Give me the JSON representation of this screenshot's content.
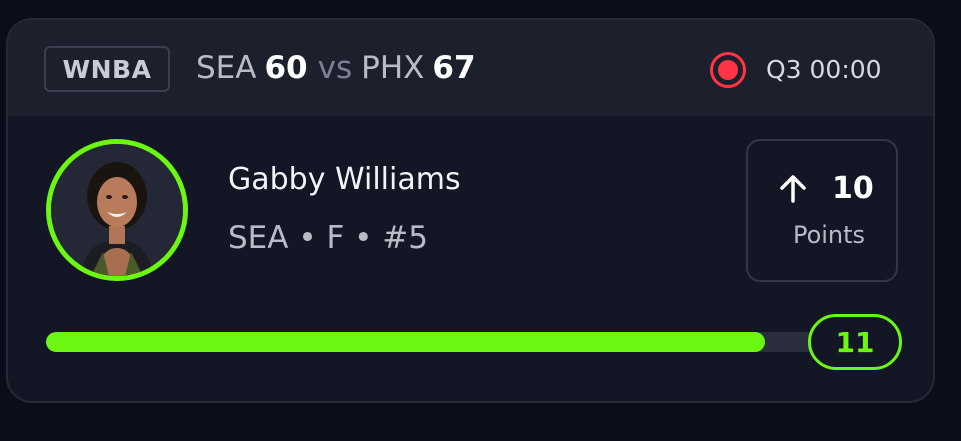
{
  "game": {
    "league": "WNBA",
    "home_team": "SEA",
    "home_score": "60",
    "vs_label": "vs",
    "away_team": "PHX",
    "away_score": "67",
    "status_icon": "live-record-icon",
    "clock": "Q3 00:00"
  },
  "player": {
    "name": "Gabby Williams",
    "meta": "SEA • F • #5"
  },
  "stat": {
    "direction_icon": "arrow-up-icon",
    "value": "10",
    "label": "Points"
  },
  "progress": {
    "fraction": 0.91,
    "target": "11"
  },
  "colors": {
    "accent_green": "#6cf712",
    "live_red": "#ff3546",
    "card_bg": "#121625",
    "header_bg": "#1c1f2c"
  }
}
